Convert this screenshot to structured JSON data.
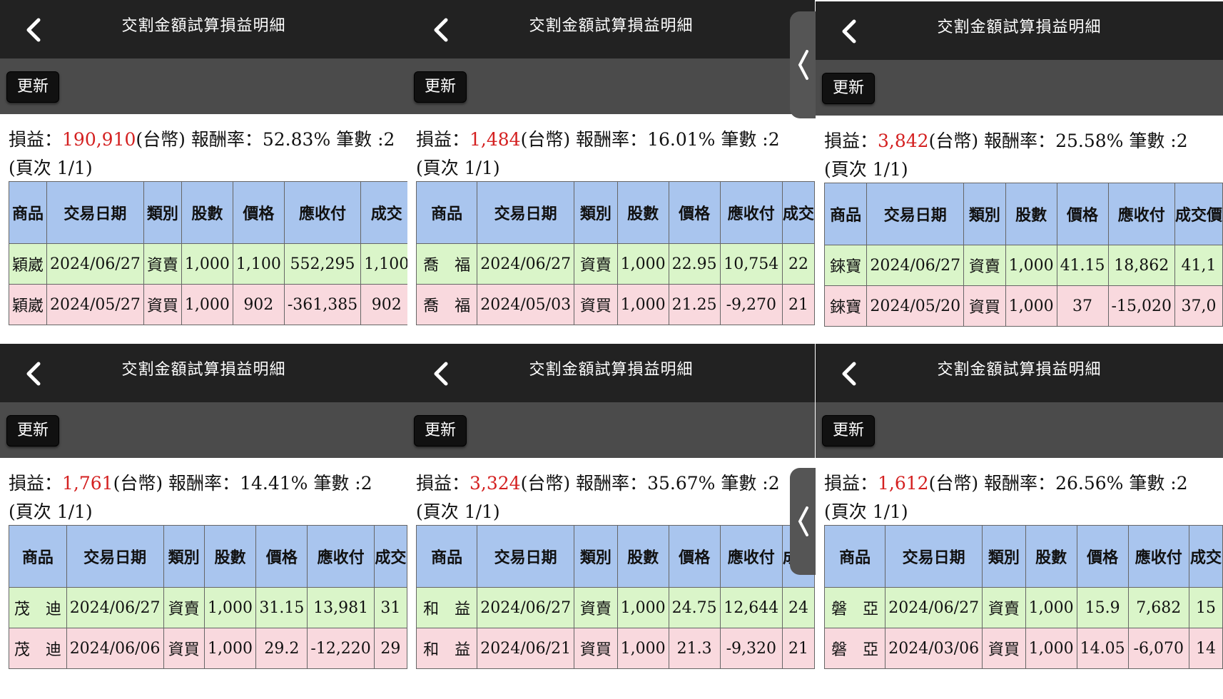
{
  "panels": [
    {
      "title": "交割金額試算損益明細",
      "refresh_label": "更新",
      "summary": {
        "label_pl": "損益：",
        "pl": "190,910",
        "currency": "(台幣)",
        "label_rate": " 報酬率：",
        "rate": "52.83%",
        "label_count": " 筆數 :",
        "count": "2"
      },
      "page": "(頁次 1/1)",
      "columns": [
        "商品",
        "交易日期",
        "類別",
        "股數",
        "價格",
        "應收付",
        "成交"
      ],
      "rows": [
        {
          "symbol": "穎崴",
          "date": "2024/06/27",
          "type": "資賣",
          "shares": "1,000",
          "price": "1,100",
          "amount": "552,295",
          "deal": "1,100"
        },
        {
          "symbol": "穎崴",
          "date": "2024/05/27",
          "type": "資買",
          "shares": "1,000",
          "price": "902",
          "amount": "-361,385",
          "deal": "902"
        }
      ]
    },
    {
      "title": "交割金額試算損益明細",
      "refresh_label": "更新",
      "summary": {
        "label_pl": "損益：",
        "pl": "1,484",
        "currency": "(台幣)",
        "label_rate": " 報酬率：",
        "rate": "16.01%",
        "label_count": " 筆數 :",
        "count": "2"
      },
      "page": "(頁次 1/1)",
      "columns": [
        "商品",
        "交易日期",
        "類別",
        "股數",
        "價格",
        "應收付",
        "成交"
      ],
      "rows": [
        {
          "symbol": "喬　福",
          "date": "2024/06/27",
          "type": "資賣",
          "shares": "1,000",
          "price": "22.95",
          "amount": "10,754",
          "deal": "22"
        },
        {
          "symbol": "喬　福",
          "date": "2024/05/03",
          "type": "資買",
          "shares": "1,000",
          "price": "21.25",
          "amount": "-9,270",
          "deal": "21"
        }
      ]
    },
    {
      "title": "交割金額試算損益明細",
      "refresh_label": "更新",
      "summary": {
        "label_pl": "損益：",
        "pl": "3,842",
        "currency": "(台幣)",
        "label_rate": " 報酬率：",
        "rate": "25.58%",
        "label_count": " 筆數 :",
        "count": "2"
      },
      "page": "(頁次 1/1)",
      "columns": [
        "商品",
        "交易日期",
        "類別",
        "股數",
        "價格",
        "應收付",
        "成交價"
      ],
      "rows": [
        {
          "symbol": "錸寶",
          "date": "2024/06/27",
          "type": "資賣",
          "shares": "1,000",
          "price": "41.15",
          "amount": "18,862",
          "deal": "41,1"
        },
        {
          "symbol": "錸寶",
          "date": "2024/05/20",
          "type": "資買",
          "shares": "1,000",
          "price": "37",
          "amount": "-15,020",
          "deal": "37,0"
        }
      ]
    },
    {
      "title": "交割金額試算損益明細",
      "refresh_label": "更新",
      "summary": {
        "label_pl": "損益：",
        "pl": "1,761",
        "currency": "(台幣)",
        "label_rate": " 報酬率：",
        "rate": "14.41%",
        "label_count": " 筆數 :",
        "count": "2"
      },
      "page": "(頁次 1/1)",
      "columns": [
        "商品",
        "交易日期",
        "類別",
        "股數",
        "價格",
        "應收付",
        "成交"
      ],
      "rows": [
        {
          "symbol": "茂　迪",
          "date": "2024/06/27",
          "type": "資賣",
          "shares": "1,000",
          "price": "31.15",
          "amount": "13,981",
          "deal": "31"
        },
        {
          "symbol": "茂　迪",
          "date": "2024/06/06",
          "type": "資買",
          "shares": "1,000",
          "price": "29.2",
          "amount": "-12,220",
          "deal": "29"
        }
      ]
    },
    {
      "title": "交割金額試算損益明細",
      "refresh_label": "更新",
      "summary": {
        "label_pl": "損益：",
        "pl": "3,324",
        "currency": "(台幣)",
        "label_rate": " 報酬率：",
        "rate": "35.67%",
        "label_count": " 筆數 :",
        "count": "2"
      },
      "page": "(頁次 1/1)",
      "columns": [
        "商品",
        "交易日期",
        "類別",
        "股數",
        "價格",
        "應收付",
        "成交"
      ],
      "rows": [
        {
          "symbol": "和　益",
          "date": "2024/06/27",
          "type": "資賣",
          "shares": "1,000",
          "price": "24.75",
          "amount": "12,644",
          "deal": "24"
        },
        {
          "symbol": "和　益",
          "date": "2024/06/21",
          "type": "資買",
          "shares": "1,000",
          "price": "21.3",
          "amount": "-9,320",
          "deal": "21"
        }
      ]
    },
    {
      "title": "交割金額試算損益明細",
      "refresh_label": "更新",
      "summary": {
        "label_pl": "損益：",
        "pl": "1,612",
        "currency": "(台幣)",
        "label_rate": " 報酬率：",
        "rate": "26.56%",
        "label_count": " 筆數 :",
        "count": "2"
      },
      "page": "(頁次 1/1)",
      "columns": [
        "商品",
        "交易日期",
        "類別",
        "股數",
        "價格",
        "應收付",
        "成交"
      ],
      "rows": [
        {
          "symbol": "磐　亞",
          "date": "2024/06/27",
          "type": "資賣",
          "shares": "1,000",
          "price": "15.9",
          "amount": "7,682",
          "deal": "15"
        },
        {
          "symbol": "磐　亞",
          "date": "2024/03/06",
          "type": "資買",
          "shares": "1,000",
          "price": "14.05",
          "amount": "-6,070",
          "deal": "14"
        }
      ]
    }
  ],
  "colors": {
    "header_bg": "#222222",
    "toolbar_bg": "#4b4b4b",
    "table_header": "#a9c5ee",
    "sell_row": "#daf5c9",
    "buy_row": "#f9d9de",
    "profit": "#d42020",
    "symbol": "#1a3fbf"
  },
  "icons": {
    "back": "chevron-left-icon",
    "side_handle": "chevron-left-icon"
  }
}
